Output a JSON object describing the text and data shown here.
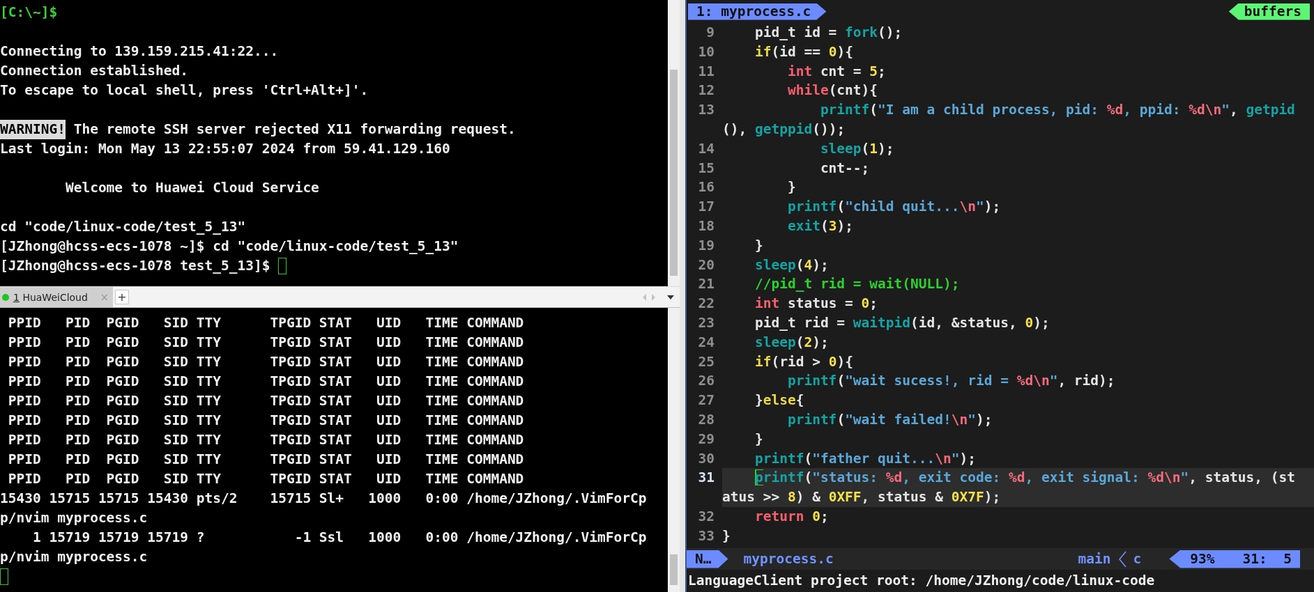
{
  "left_terminal": {
    "lines": [
      {
        "segments": [
          {
            "text": "[C:\\~]$",
            "kind": "prompt"
          }
        ],
        "spaced": false,
        "cursor": false
      },
      {
        "segments": [
          {
            "text": "Connecting to 139.159.215.41:22...",
            "kind": "plain"
          }
        ],
        "spaced": true,
        "cursor": false
      },
      {
        "segments": [
          {
            "text": "Connection established.",
            "kind": "plain"
          }
        ],
        "spaced": false,
        "cursor": false
      },
      {
        "segments": [
          {
            "text": "To escape to local shell, press 'Ctrl+Alt+]'.",
            "kind": "plain"
          }
        ],
        "spaced": false,
        "cursor": false
      },
      {
        "segments": [
          {
            "text": "WARNING!",
            "kind": "highlight"
          },
          {
            "text": " The remote SSH server rejected X11 forwarding request.",
            "kind": "plain"
          }
        ],
        "spaced": true,
        "cursor": false
      },
      {
        "segments": [
          {
            "text": "Last login: Mon May 13 22:55:07 2024 from 59.41.129.160",
            "kind": "plain"
          }
        ],
        "spaced": false,
        "cursor": false
      },
      {
        "segments": [
          {
            "text": "        Welcome to Huawei Cloud Service",
            "kind": "plain"
          }
        ],
        "spaced": true,
        "cursor": false
      },
      {
        "segments": [
          {
            "text": "cd \"code/linux-code/test_5_13\"",
            "kind": "plain"
          }
        ],
        "spaced": true,
        "cursor": false
      },
      {
        "segments": [
          {
            "text": "[JZhong@hcss-ecs-1078 ~]$ cd \"code/linux-code/test_5_13\"",
            "kind": "plain"
          }
        ],
        "spaced": false,
        "cursor": false
      },
      {
        "segments": [
          {
            "text": "[JZhong@hcss-ecs-1078 test_5_13]$ ",
            "kind": "plain"
          }
        ],
        "spaced": false,
        "cursor": true
      }
    ]
  },
  "session_tabs": {
    "tabs": [
      {
        "number": "1",
        "label": "HuaWeiCloud",
        "close": "×",
        "color": "#22c322",
        "selected": true
      }
    ],
    "add": "+"
  },
  "bottom_terminal": {
    "lines": [
      " PPID   PID  PGID   SID TTY      TPGID STAT   UID   TIME COMMAND",
      " PPID   PID  PGID   SID TTY      TPGID STAT   UID   TIME COMMAND",
      " PPID   PID  PGID   SID TTY      TPGID STAT   UID   TIME COMMAND",
      " PPID   PID  PGID   SID TTY      TPGID STAT   UID   TIME COMMAND",
      " PPID   PID  PGID   SID TTY      TPGID STAT   UID   TIME COMMAND",
      " PPID   PID  PGID   SID TTY      TPGID STAT   UID   TIME COMMAND",
      " PPID   PID  PGID   SID TTY      TPGID STAT   UID   TIME COMMAND",
      " PPID   PID  PGID   SID TTY      TPGID STAT   UID   TIME COMMAND",
      " PPID   PID  PGID   SID TTY      TPGID STAT   UID   TIME COMMAND",
      "15430 15715 15715 15430 pts/2    15715 Sl+   1000   0:00 /home/JZhong/.VimForCp",
      "p/nvim myprocess.c",
      "    1 15719 15719 15719 ?           -1 Ssl   1000   0:00 /home/JZhong/.VimForCp",
      "p/nvim myprocess.c"
    ],
    "cursor": true
  },
  "editor": {
    "buffer_tab": "1: myprocess.c",
    "buffers_label": "buffers",
    "lines": [
      {
        "number": "9",
        "current": false,
        "tokens": [
          {
            "t": "    pid_t id = ",
            "kind": "plain"
          },
          {
            "t": "fork",
            "kind": "function"
          },
          {
            "t": "();",
            "kind": "plain"
          }
        ]
      },
      {
        "number": "10",
        "current": false,
        "tokens": [
          {
            "t": "    if",
            "kind": "keyword"
          },
          {
            "t": "(id == ",
            "kind": "plain"
          },
          {
            "t": "0",
            "kind": "number"
          },
          {
            "t": "){",
            "kind": "plain"
          }
        ]
      },
      {
        "number": "11",
        "current": false,
        "tokens": [
          {
            "t": "        int",
            "kind": "type"
          },
          {
            "t": " cnt = ",
            "kind": "plain"
          },
          {
            "t": "5",
            "kind": "number"
          },
          {
            "t": ";",
            "kind": "plain"
          }
        ]
      },
      {
        "number": "12",
        "current": false,
        "tokens": [
          {
            "t": "        while",
            "kind": "type"
          },
          {
            "t": "(cnt){",
            "kind": "plain"
          }
        ]
      },
      {
        "number": "13",
        "current": false,
        "tokens": [
          {
            "t": "            printf",
            "kind": "function"
          },
          {
            "t": "(",
            "kind": "plain"
          },
          {
            "t": "\"I am a child process, pid: ",
            "kind": "string"
          },
          {
            "t": "%d",
            "kind": "escape"
          },
          {
            "t": ", ppid: ",
            "kind": "string"
          },
          {
            "t": "%d\\n",
            "kind": "escape"
          },
          {
            "t": "\"",
            "kind": "string"
          },
          {
            "t": ", ",
            "kind": "plain"
          },
          {
            "t": "getpid",
            "kind": "function"
          }
        ]
      },
      {
        "current": false,
        "tokens": [
          {
            "t": "(), ",
            "kind": "plain"
          },
          {
            "t": "getppid",
            "kind": "function"
          },
          {
            "t": "());",
            "kind": "plain"
          }
        ]
      },
      {
        "number": "14",
        "current": false,
        "tokens": [
          {
            "t": "            sleep",
            "kind": "function"
          },
          {
            "t": "(",
            "kind": "plain"
          },
          {
            "t": "1",
            "kind": "number"
          },
          {
            "t": ");",
            "kind": "plain"
          }
        ]
      },
      {
        "number": "15",
        "current": false,
        "tokens": [
          {
            "t": "            cnt--;",
            "kind": "plain"
          }
        ]
      },
      {
        "number": "16",
        "current": false,
        "tokens": [
          {
            "t": "        }",
            "kind": "plain"
          }
        ]
      },
      {
        "number": "17",
        "current": false,
        "tokens": [
          {
            "t": "        printf",
            "kind": "function"
          },
          {
            "t": "(",
            "kind": "plain"
          },
          {
            "t": "\"child quit...",
            "kind": "string"
          },
          {
            "t": "\\n",
            "kind": "escape"
          },
          {
            "t": "\"",
            "kind": "string"
          },
          {
            "t": ");",
            "kind": "plain"
          }
        ]
      },
      {
        "number": "18",
        "current": false,
        "tokens": [
          {
            "t": "        exit",
            "kind": "function"
          },
          {
            "t": "(",
            "kind": "plain"
          },
          {
            "t": "3",
            "kind": "number"
          },
          {
            "t": ");",
            "kind": "plain"
          }
        ]
      },
      {
        "number": "19",
        "current": false,
        "tokens": [
          {
            "t": "    }",
            "kind": "plain"
          }
        ]
      },
      {
        "number": "20",
        "current": false,
        "tokens": [
          {
            "t": "    sleep",
            "kind": "function"
          },
          {
            "t": "(",
            "kind": "plain"
          },
          {
            "t": "4",
            "kind": "number"
          },
          {
            "t": ");",
            "kind": "plain"
          }
        ]
      },
      {
        "number": "21",
        "current": false,
        "tokens": [
          {
            "t": "    //pid_t rid = wait(NULL);",
            "kind": "comment"
          }
        ]
      },
      {
        "number": "22",
        "current": false,
        "tokens": [
          {
            "t": "    int",
            "kind": "type"
          },
          {
            "t": " status = ",
            "kind": "plain"
          },
          {
            "t": "0",
            "kind": "number"
          },
          {
            "t": ";",
            "kind": "plain"
          }
        ]
      },
      {
        "number": "23",
        "current": false,
        "tokens": [
          {
            "t": "    pid_t rid = ",
            "kind": "plain"
          },
          {
            "t": "waitpid",
            "kind": "function"
          },
          {
            "t": "(id, &status, ",
            "kind": "plain"
          },
          {
            "t": "0",
            "kind": "number"
          },
          {
            "t": ");",
            "kind": "plain"
          }
        ]
      },
      {
        "number": "24",
        "current": false,
        "tokens": [
          {
            "t": "    sleep",
            "kind": "function"
          },
          {
            "t": "(",
            "kind": "plain"
          },
          {
            "t": "2",
            "kind": "number"
          },
          {
            "t": ");",
            "kind": "plain"
          }
        ]
      },
      {
        "number": "25",
        "current": false,
        "tokens": [
          {
            "t": "    if",
            "kind": "keyword"
          },
          {
            "t": "(rid > ",
            "kind": "plain"
          },
          {
            "t": "0",
            "kind": "number"
          },
          {
            "t": "){",
            "kind": "plain"
          }
        ]
      },
      {
        "number": "26",
        "current": false,
        "tokens": [
          {
            "t": "        printf",
            "kind": "function"
          },
          {
            "t": "(",
            "kind": "plain"
          },
          {
            "t": "\"wait sucess!, rid = ",
            "kind": "string"
          },
          {
            "t": "%d\\n",
            "kind": "escape"
          },
          {
            "t": "\"",
            "kind": "string"
          },
          {
            "t": ", rid);",
            "kind": "plain"
          }
        ]
      },
      {
        "number": "27",
        "current": false,
        "tokens": [
          {
            "t": "    }",
            "kind": "plain"
          },
          {
            "t": "else",
            "kind": "keyword"
          },
          {
            "t": "{",
            "kind": "plain"
          }
        ]
      },
      {
        "number": "28",
        "current": false,
        "tokens": [
          {
            "t": "        printf",
            "kind": "function"
          },
          {
            "t": "(",
            "kind": "plain"
          },
          {
            "t": "\"wait failed!",
            "kind": "string"
          },
          {
            "t": "\\n",
            "kind": "escape"
          },
          {
            "t": "\"",
            "kind": "string"
          },
          {
            "t": ");",
            "kind": "plain"
          }
        ]
      },
      {
        "number": "29",
        "current": false,
        "tokens": [
          {
            "t": "    }",
            "kind": "plain"
          }
        ]
      },
      {
        "number": "30",
        "current": false,
        "tokens": [
          {
            "t": "    printf",
            "kind": "function"
          },
          {
            "t": "(",
            "kind": "plain"
          },
          {
            "t": "\"father quit...",
            "kind": "string"
          },
          {
            "t": "\\n",
            "kind": "escape"
          },
          {
            "t": "\"",
            "kind": "string"
          },
          {
            "t": ");",
            "kind": "plain"
          }
        ]
      },
      {
        "number": "31",
        "current": true,
        "tokens": [
          {
            "t": "    p",
            "kind": "function",
            "cursor": true
          },
          {
            "t": "rintf",
            "kind": "function"
          },
          {
            "t": "(",
            "kind": "plain"
          },
          {
            "t": "\"status: ",
            "kind": "string"
          },
          {
            "t": "%d",
            "kind": "escape"
          },
          {
            "t": ", exit code: ",
            "kind": "string"
          },
          {
            "t": "%d",
            "kind": "escape"
          },
          {
            "t": ", exit signal: ",
            "kind": "string"
          },
          {
            "t": "%d\\n",
            "kind": "escape"
          },
          {
            "t": "\"",
            "kind": "string"
          },
          {
            "t": ", status, (st",
            "kind": "plain"
          }
        ]
      },
      {
        "current": true,
        "tokens": [
          {
            "t": "atus >> ",
            "kind": "plain"
          },
          {
            "t": "8",
            "kind": "number"
          },
          {
            "t": ") & ",
            "kind": "plain"
          },
          {
            "t": "0XFF",
            "kind": "number"
          },
          {
            "t": ", status & ",
            "kind": "plain"
          },
          {
            "t": "0X7F",
            "kind": "number"
          },
          {
            "t": ");",
            "kind": "plain"
          }
        ]
      },
      {
        "number": "32",
        "current": false,
        "tokens": [
          {
            "t": "    return",
            "kind": "type"
          },
          {
            "t": " 0",
            "kind": "number"
          },
          {
            "t": ";",
            "kind": "plain"
          }
        ]
      },
      {
        "number": "33",
        "current": false,
        "tokens": [
          {
            "t": "}",
            "kind": "plain"
          }
        ]
      }
    ],
    "status_line": {
      "mode": "N…",
      "file": "myprocess.c",
      "branch": "main",
      "filetype": "c",
      "percent": "93%",
      "position": "31:  5"
    },
    "message": "LanguageClient project root: /home/JZhong/code/linux-code"
  }
}
